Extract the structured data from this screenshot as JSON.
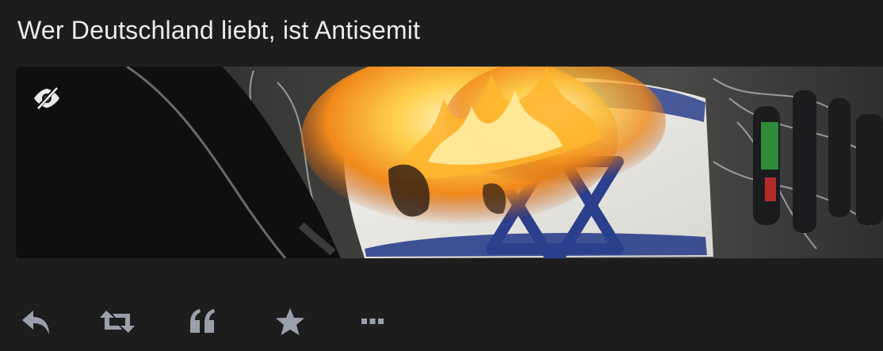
{
  "post": {
    "title": "Wer Deutschland liebt, ist Antisemit"
  },
  "media": {
    "description_icon": "eye-slash-icon"
  },
  "actions": [
    {
      "name": "reply",
      "icon": "reply-icon"
    },
    {
      "name": "boost",
      "icon": "retweet-icon"
    },
    {
      "name": "quote",
      "icon": "quote-icon"
    },
    {
      "name": "favourite",
      "icon": "star-icon"
    },
    {
      "name": "more",
      "icon": "ellipsis-icon"
    }
  ],
  "colors": {
    "background": "#1d1d1e",
    "title_text": "#ececec",
    "action_icon": "#9aa0ab"
  }
}
